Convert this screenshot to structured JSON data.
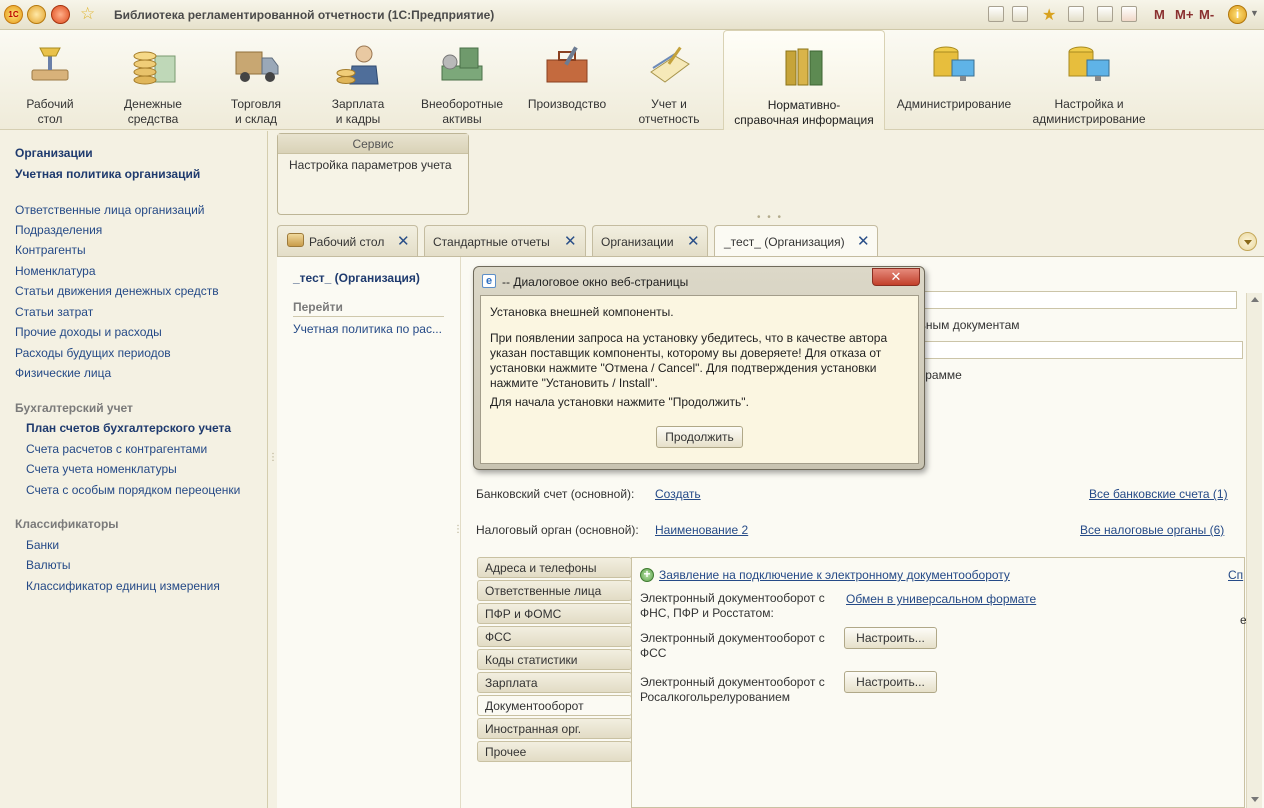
{
  "window": {
    "title": "Библиотека регламентированной отчетности (1С:Предприятие)",
    "tool_m": "M",
    "tool_mplus": "M+",
    "tool_mminus": "M-",
    "accent": "#f1eee0"
  },
  "sections": [
    {
      "line1": "Рабочий",
      "line2": "стол"
    },
    {
      "line1": "Денежные",
      "line2": "средства"
    },
    {
      "line1": "Торговля",
      "line2": "и склад"
    },
    {
      "line1": "Зарплата",
      "line2": "и кадры"
    },
    {
      "line1": "Внеоборотные",
      "line2": "активы"
    },
    {
      "line1": "Производство",
      "line2": ""
    },
    {
      "line1": "Учет и",
      "line2": "отчетность"
    },
    {
      "line1": "Нормативно-",
      "line2": "справочная информация"
    },
    {
      "line1": "Администрирование",
      "line2": ""
    },
    {
      "line1": "Настройка и",
      "line2": "администрирование"
    }
  ],
  "leftnav": {
    "top_items": [
      "Организации",
      "Учетная политика организаций"
    ],
    "items": [
      "Ответственные лица организаций",
      "Подразделения",
      "Контрагенты",
      "Номенклатура",
      "Статьи движения денежных средств",
      "Статьи затрат",
      "Прочие доходы и расходы",
      "Расходы будущих периодов",
      "Физические лица"
    ],
    "group_accounting": "Бухгалтерский учет",
    "accounting_items": [
      "План счетов бухгалтерского учета",
      "Счета расчетов с контрагентами",
      "Счета учета номенклатуры",
      "Счета с особым порядком переоценки"
    ],
    "group_classifiers": "Классификаторы",
    "classifier_items": [
      "Банки",
      "Валюты",
      "Классификатор единиц измерения"
    ]
  },
  "service": {
    "header": "Сервис",
    "item": "Настройка параметров учета"
  },
  "tabs": [
    {
      "label": "Рабочий стол"
    },
    {
      "label": "Стандартные отчеты"
    },
    {
      "label": "Организации"
    },
    {
      "label": "_тест_ (Организация)"
    }
  ],
  "form": {
    "title": "_тест_ (Организация)",
    "goto_header": "Перейти",
    "goto_item": "Учетная политика по рас...",
    "hidden_text1": "тельным документам",
    "hidden_text2": "программе",
    "bank_label": "Банковский счет (основной):",
    "bank_link": "Создать",
    "bank_all": "Все банковские счета (1)",
    "tax_label": "Налоговый орган (основной):",
    "tax_link": "Наименование 2",
    "tax_all": "Все налоговые органы (6)"
  },
  "vtabs": [
    "Адреса и телефоны",
    "Ответственные лица",
    "ПФР и ФОМС",
    "ФСС",
    "Коды статистики",
    "Зарплата",
    "Документооборот",
    "Иностранная орг.",
    "Прочее"
  ],
  "edo": {
    "application_link": "Заявление на подключение к электронному документообороту",
    "right_link": "Сп",
    "row1_line1": "Электронный документооборот с",
    "row1_line2": "ФНС, ПФР и Росстатом:",
    "row1_link": "Обмен в универсальном формате",
    "row2_line1": "Электронный документооборот с",
    "row2_line2": "ФСС",
    "row2_btn": "Настроить...",
    "row3_line1": "Электронный документооборот с",
    "row3_line2": "Росалкогольрелурованием",
    "row3_btn": "Настроить...",
    "edge_char": "е"
  },
  "dialog": {
    "title": "-- Диалоговое окно веб-страницы",
    "close": "✕",
    "line1": "Установка внешней компоненты.",
    "line2": "При появлении запроса на установку убедитесь, что в качестве автора",
    "line3": "указан поставщик компоненты, которому вы доверяете! Для отказа от",
    "line4": "установки нажмите \"Отмена / Cancel\". Для подтверждения установки",
    "line5": "нажмите \"Установить / Install\".",
    "line6": "Для начала установки нажмите \"Продолжить\".",
    "button": "Продолжить"
  }
}
